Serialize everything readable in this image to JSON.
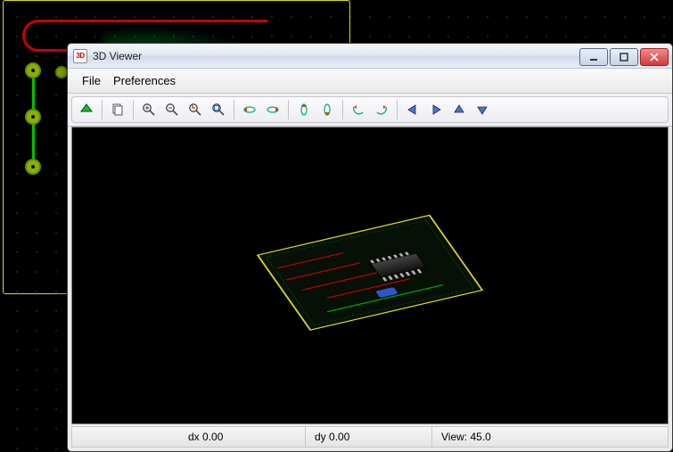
{
  "window": {
    "title": "3D Viewer",
    "app_icon_text": "3D"
  },
  "menu": {
    "file": "File",
    "preferences": "Preferences"
  },
  "toolbar": {
    "reload": "reload",
    "copy": "copy",
    "zoom_in": "zoom-in",
    "zoom_out": "zoom-out",
    "zoom_redraw": "redraw",
    "zoom_fit": "fit",
    "rot_x_neg": "rotate-x-neg",
    "rot_x_pos": "rotate-x-pos",
    "rot_y_neg": "rotate-y-neg",
    "rot_y_pos": "rotate-y-pos",
    "rot_z_neg": "rotate-z-neg",
    "rot_z_pos": "rotate-z-pos",
    "pan_left": "pan-left",
    "pan_right": "pan-right",
    "pan_up": "pan-up",
    "pan_down": "pan-down"
  },
  "status": {
    "dx_label": "dx",
    "dx_value": "0.00",
    "dy_label": "dy",
    "dy_value": "0.00",
    "view_label": "View:",
    "view_value": "45.0"
  }
}
